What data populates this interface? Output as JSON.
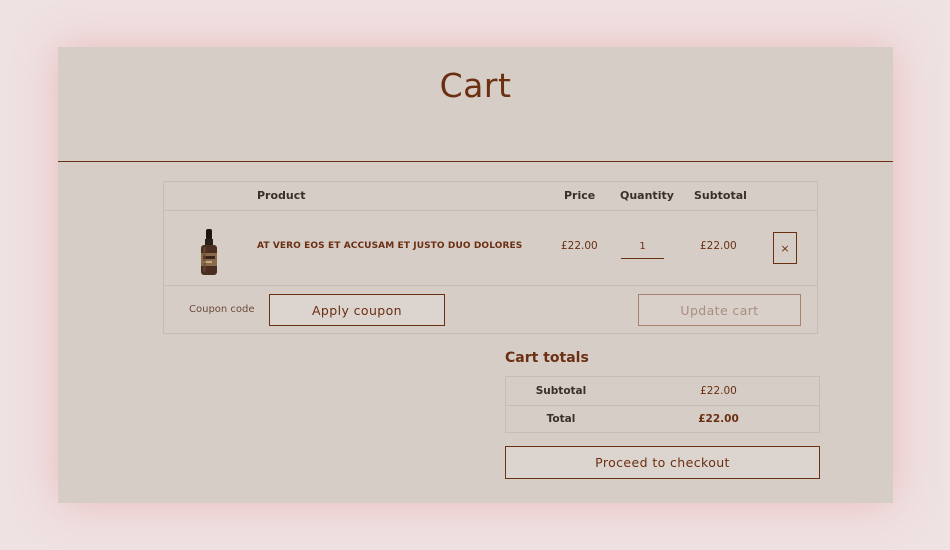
{
  "page": {
    "title": "Cart"
  },
  "cart_table": {
    "headers": {
      "product": "Product",
      "price": "Price",
      "quantity": "Quantity",
      "subtotal": "Subtotal"
    },
    "items": [
      {
        "name": "AT VERO EOS ET ACCUSAM ET JUSTO DUO DOLORES",
        "price": "£22.00",
        "quantity": "1",
        "subtotal": "£22.00",
        "image_icon": "dropper-bottle-icon",
        "remove_label": "×"
      }
    ]
  },
  "actions": {
    "coupon_placeholder": "Coupon code",
    "apply_coupon": "Apply coupon",
    "update_cart": "Update cart"
  },
  "cart_totals": {
    "title": "Cart totals",
    "subtotal_label": "Subtotal",
    "subtotal_value": "£22.00",
    "total_label": "Total",
    "total_value": "£22.00",
    "checkout_label": "Proceed to checkout"
  },
  "colors": {
    "background": "#efe2e3",
    "panel": "#d6cdc7",
    "accent": "#6b2f12",
    "text_dark": "#3a302b"
  }
}
